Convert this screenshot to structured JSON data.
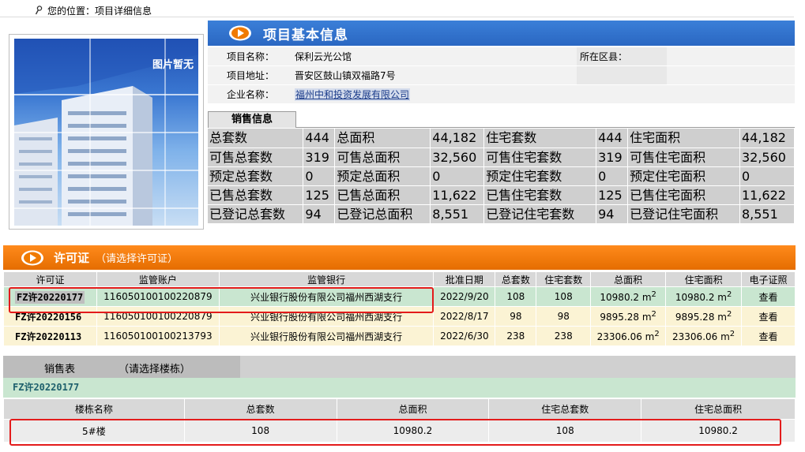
{
  "breadcrumb": {
    "prefix": "您的位置：",
    "current": "项目详细信息"
  },
  "photo": {
    "label": "图片暂无"
  },
  "project": {
    "title": "项目基本信息",
    "name_label": "项目名称：",
    "name": "保利云光公馆",
    "district_label": "所在区县：",
    "district": "",
    "address_label": "项目地址：",
    "address": "晋安区鼓山镇双福路7号",
    "company_label": "企业名称：",
    "company": "福州中和投资发展有限公司"
  },
  "sales_tab": "销售信息",
  "stats": [
    [
      "总套数",
      "444",
      "总面积",
      "44,182",
      "住宅套数",
      "444",
      "住宅面积",
      "44,182"
    ],
    [
      "可售总套数",
      "319",
      "可售总面积",
      "32,560",
      "可售住宅套数",
      "319",
      "可售住宅面积",
      "32,560"
    ],
    [
      "预定总套数",
      "0",
      "预定总面积",
      "0",
      "预定住宅套数",
      "0",
      "预定住宅面积",
      "0"
    ],
    [
      "已售总套数",
      "125",
      "已售总面积",
      "11,622",
      "已售住宅套数",
      "125",
      "已售住宅面积",
      "11,622"
    ],
    [
      "已登记总套数",
      "94",
      "已登记总面积",
      "8,551",
      "已登记住宅套数",
      "94",
      "已登记住宅面积",
      "8,551"
    ]
  ],
  "permits": {
    "title": "许可证",
    "subtitle": "（请选择许可证）",
    "headers": [
      "许可证",
      "监管账户",
      "监管银行",
      "批准日期",
      "总套数",
      "住宅套数",
      "总面积",
      "住宅面积",
      "电子证照"
    ],
    "rows": [
      [
        "FZ许20220177",
        "116050100100220879",
        "兴业银行股份有限公司福州西湖支行",
        "2022/9/20",
        "108",
        "108",
        "10980.2 m",
        "10980.2 m",
        "查看"
      ],
      [
        "FZ许20220156",
        "116050100100220879",
        "兴业银行股份有限公司福州西湖支行",
        "2022/8/17",
        "98",
        "98",
        "9895.28 m",
        "9895.28 m",
        "查看"
      ],
      [
        "FZ许20220113",
        "116050100100213793",
        "兴业银行股份有限公司福州西湖支行",
        "2022/6/30",
        "238",
        "238",
        "23306.06 m",
        "23306.06 m",
        "查看"
      ]
    ],
    "area_sup": "2"
  },
  "sales_table": {
    "title": "销售表",
    "hint": "（请选择楼栋）",
    "selected_permit": "FZ许20220177"
  },
  "buildings": {
    "headers": [
      "楼栋名称",
      "总套数",
      "总面积",
      "住宅总套数",
      "住宅总面积"
    ],
    "rows": [
      [
        "5#楼",
        "108",
        "10980.2",
        "108",
        "10980.2"
      ]
    ]
  },
  "colors": {
    "blue_header": "#2a67c2",
    "orange_header": "#e56d00",
    "highlight_red": "#e31b1b",
    "selected_row": "#c9e6d0"
  }
}
